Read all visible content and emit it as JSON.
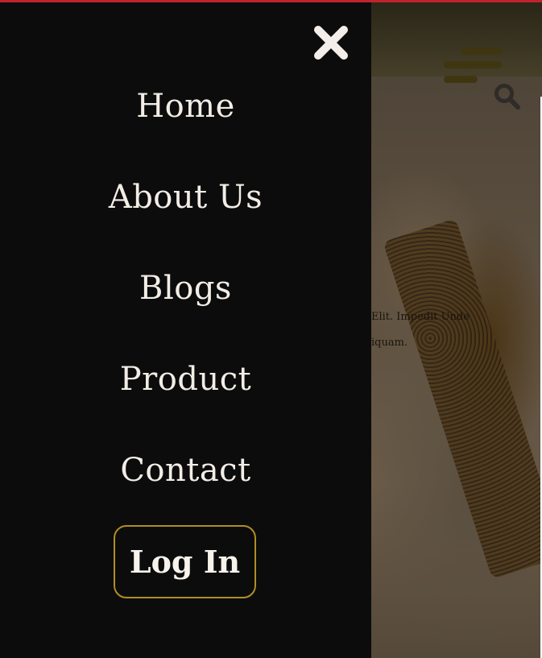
{
  "menu": {
    "items": [
      {
        "label": "Home"
      },
      {
        "label": "About Us"
      },
      {
        "label": "Blogs"
      },
      {
        "label": "Product"
      },
      {
        "label": "Contact"
      }
    ],
    "login_label": "Log In",
    "close_icon": "close-icon"
  },
  "background": {
    "hero_text_line1": "Elit. Impedit Unde",
    "hero_text_line2": "iquam.",
    "hamburger_icon": "hamburger-icon",
    "search_icon": "search-icon"
  },
  "colors": {
    "drawer_bg": "#0c0c0c",
    "menu_text": "#f2ede6",
    "accent_gold": "#b08e22",
    "top_bar": "#c0232e"
  }
}
